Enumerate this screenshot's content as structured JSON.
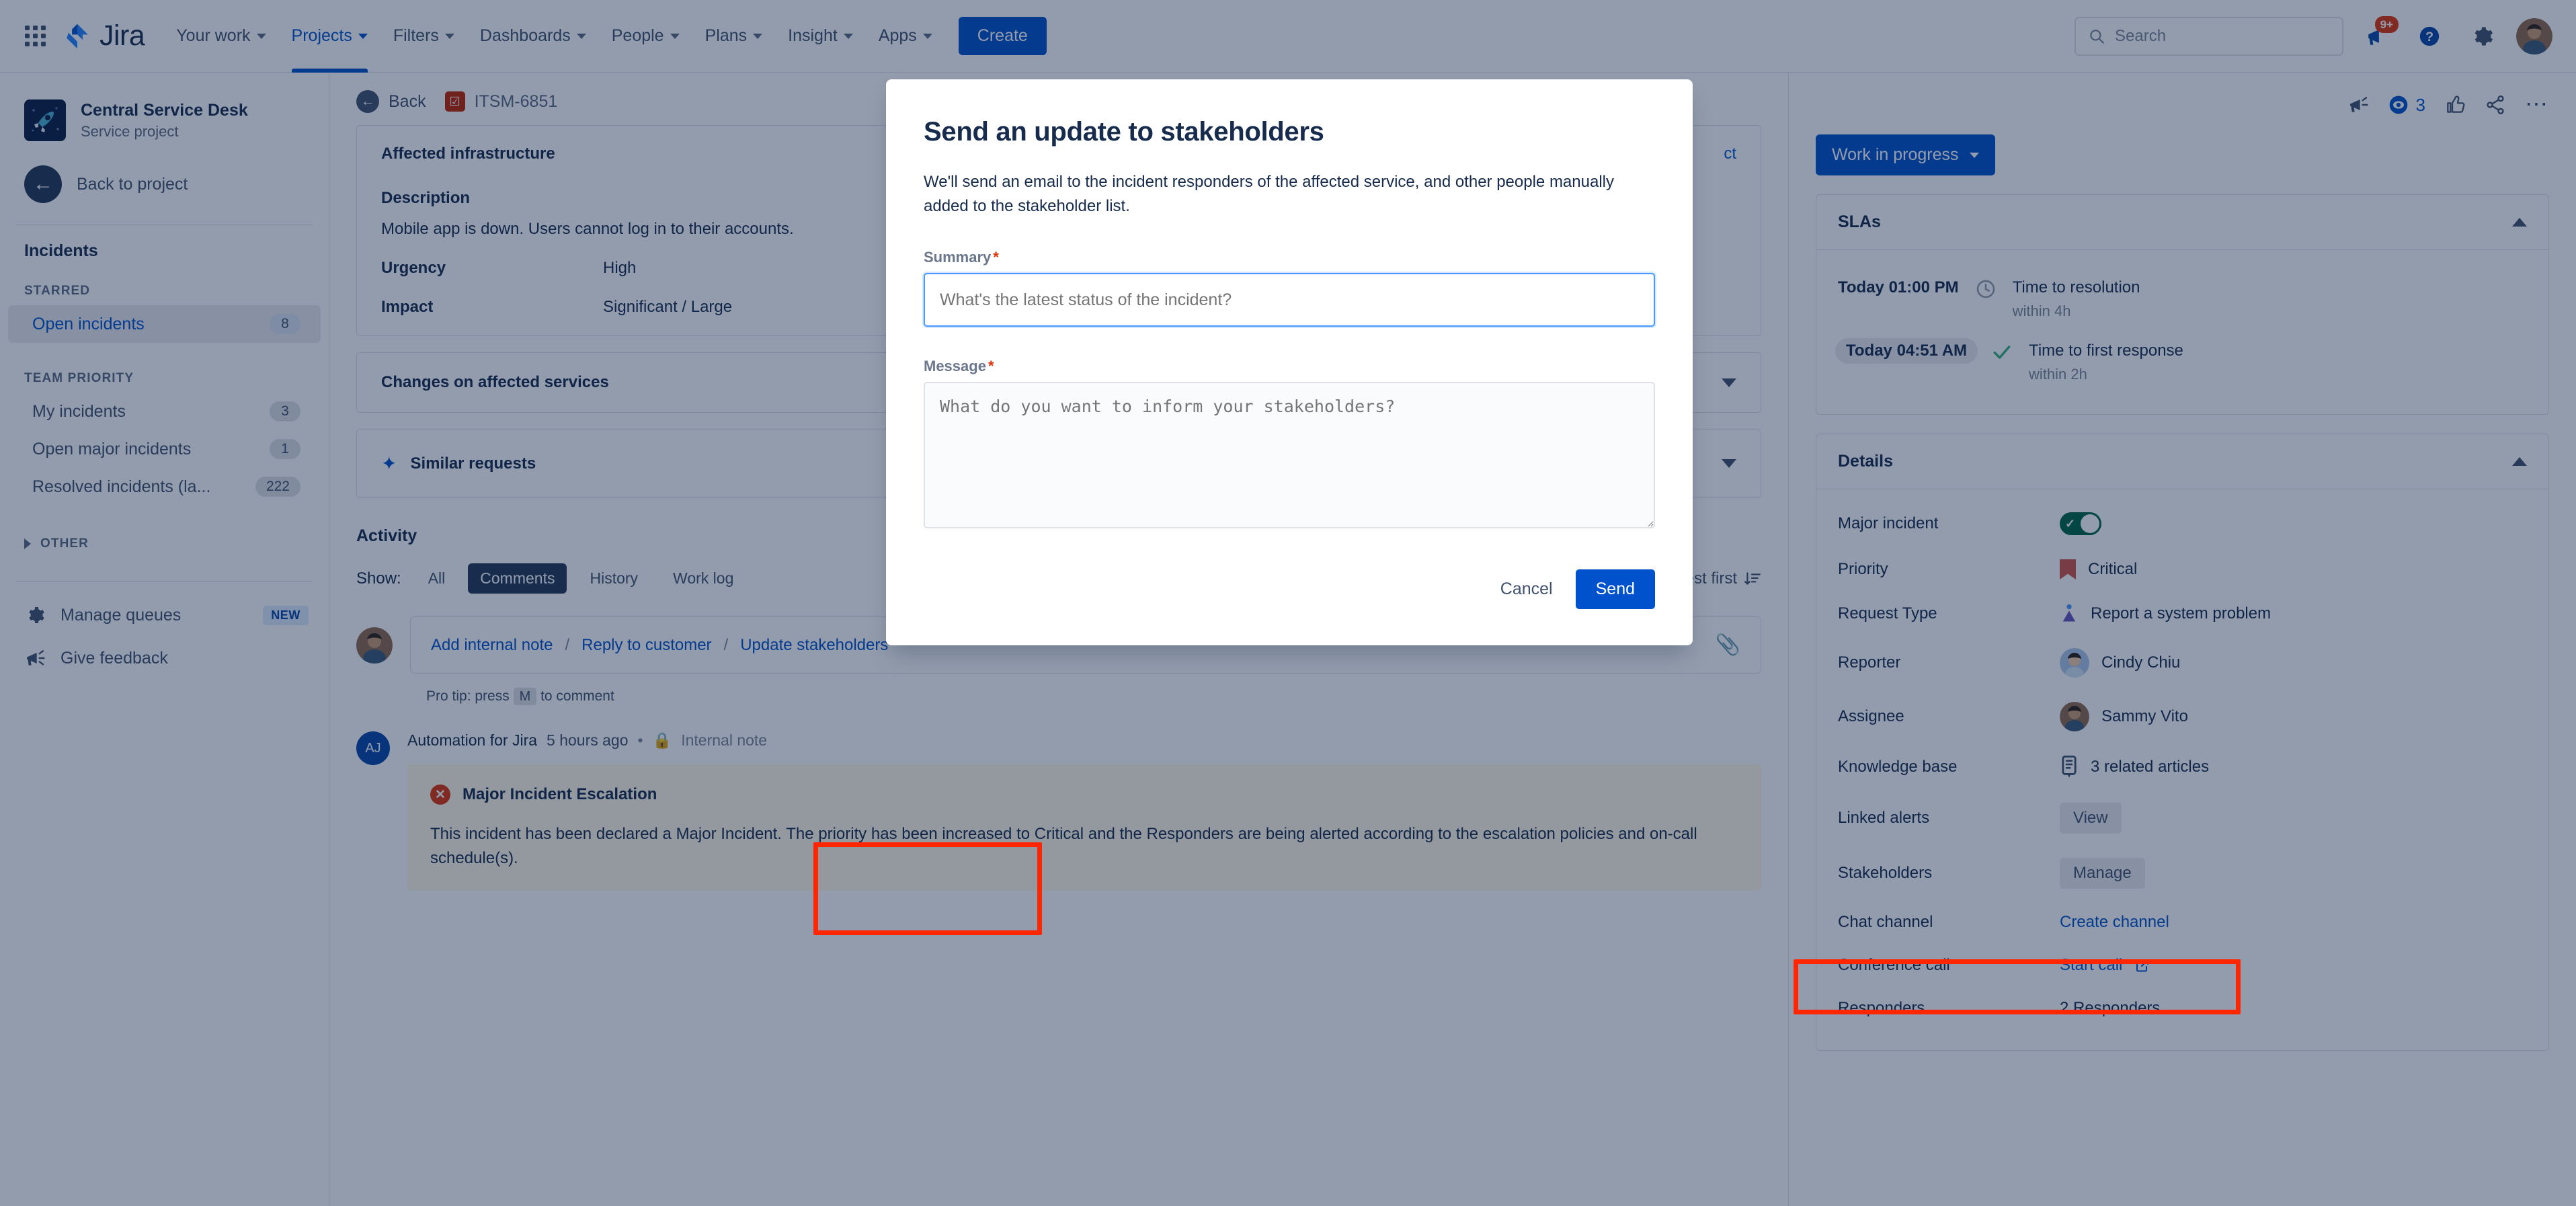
{
  "topnav": {
    "app_switcher": "app-switcher",
    "product_name": "Jira",
    "items": [
      {
        "label": "Your work",
        "active": false
      },
      {
        "label": "Projects",
        "active": true
      },
      {
        "label": "Filters",
        "active": false
      },
      {
        "label": "Dashboards",
        "active": false
      },
      {
        "label": "People",
        "active": false
      },
      {
        "label": "Plans",
        "active": false
      },
      {
        "label": "Insight",
        "active": false
      },
      {
        "label": "Apps",
        "active": false
      }
    ],
    "create_label": "Create",
    "search_placeholder": "Search",
    "notification_badge": "9+"
  },
  "sidebar": {
    "project_name": "Central Service Desk",
    "project_type": "Service project",
    "back_to_project": "Back to project",
    "queues_title": "Incidents",
    "starred_header": "STARRED",
    "starred_items": [
      {
        "label": "Open incidents",
        "count": "8",
        "selected": true
      }
    ],
    "team_priority_header": "TEAM PRIORITY",
    "team_priority_items": [
      {
        "label": "My incidents",
        "count": "3"
      },
      {
        "label": "Open major incidents",
        "count": "1"
      },
      {
        "label": "Resolved incidents (la...",
        "count": "222"
      }
    ],
    "other_header": "OTHER",
    "manage_queues": "Manage queues",
    "manage_queues_badge": "NEW",
    "give_feedback": "Give feedback"
  },
  "breadcrumb": {
    "back_label": "Back",
    "issue_key": "ITSM-6851"
  },
  "main": {
    "affected_infra_title": "Affected infrastructure",
    "affected_infra_link": "ct",
    "description_label": "Description",
    "description_text": "Mobile app is down. Users cannot log in to their accounts.",
    "urgency_label": "Urgency",
    "urgency_value": "High",
    "impact_label": "Impact",
    "impact_value": "Significant / Large",
    "changes_card_title": "Changes on affected services",
    "similar_requests_title": "Similar requests",
    "activity": {
      "title": "Activity",
      "show_label": "Show:",
      "tabs": [
        {
          "label": "All",
          "active": false
        },
        {
          "label": "Comments",
          "active": true
        },
        {
          "label": "History",
          "active": false
        },
        {
          "label": "Work log",
          "active": false
        }
      ],
      "sort_label": "Newest first",
      "add_internal_note": "Add internal note",
      "reply_to_customer": "Reply to customer",
      "update_stakeholders": "Update stakeholders",
      "separator": "/",
      "pro_tip_prefix": "Pro tip: press",
      "pro_tip_key": "M",
      "pro_tip_suffix": "to comment"
    },
    "note": {
      "author_initials": "AJ",
      "author": "Automation for Jira",
      "timestamp": "5 hours ago",
      "dot": "•",
      "visibility": "Internal note",
      "title": "Major Incident Escalation",
      "body": "This incident has been declared a Major Incident. The priority has been increased to Critical and the Responders are being alerted according to the escalation policies and on-call schedule(s)."
    }
  },
  "rightpanel": {
    "watch_count": "3",
    "status": "Work in progress",
    "slas": {
      "title": "SLAs",
      "rows": [
        {
          "time": "Today 01:00 PM",
          "name": "Time to resolution",
          "sub": "within 4h",
          "met": false
        },
        {
          "time": "Today 04:51 AM",
          "name": "Time to first response",
          "sub": "within 2h",
          "met": true
        }
      ]
    },
    "details": {
      "title": "Details",
      "rows": [
        {
          "label": "Major incident",
          "value": "",
          "kind": "toggle"
        },
        {
          "label": "Priority",
          "value": "Critical",
          "kind": "priority"
        },
        {
          "label": "Request Type",
          "value": "Report a system problem",
          "kind": "request-type"
        },
        {
          "label": "Reporter",
          "value": "Cindy Chiu",
          "kind": "avatar"
        },
        {
          "label": "Assignee",
          "value": "Sammy Vito",
          "kind": "avatar"
        },
        {
          "label": "Knowledge base",
          "value": "3 related articles",
          "kind": "kb"
        },
        {
          "label": "Linked alerts",
          "value": "View",
          "kind": "button"
        },
        {
          "label": "Stakeholders",
          "value": "Manage",
          "kind": "button"
        },
        {
          "label": "Chat channel",
          "value": "Create channel",
          "kind": "link"
        },
        {
          "label": "Conference call",
          "value": "Start call",
          "kind": "link-external"
        },
        {
          "label": "Responders",
          "value": "2 Responders",
          "kind": "text"
        }
      ]
    }
  },
  "modal": {
    "title": "Send an update to stakeholders",
    "description": "We'll send an email to the incident responders of the affected service, and other people manually added to the stakeholder list.",
    "summary_label": "Summary",
    "summary_required": "*",
    "summary_value": "",
    "summary_placeholder": "What's the latest status of the incident?",
    "message_label": "Message",
    "message_required": "*",
    "message_value": "",
    "message_placeholder": "What do you want to inform your stakeholders?",
    "cancel_label": "Cancel",
    "send_label": "Send"
  },
  "annotations": {
    "highlight_color": "#ff2600",
    "highlight_1": "update-stakeholders-link",
    "highlight_2": "stakeholders-details-row"
  }
}
